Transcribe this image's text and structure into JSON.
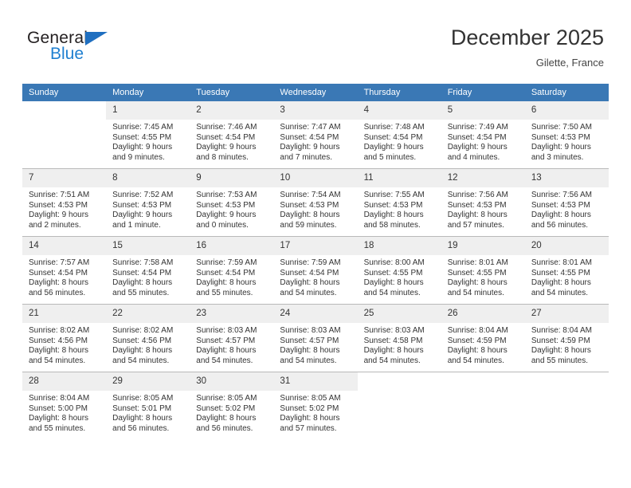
{
  "brand": {
    "name_part1": "General",
    "name_part2": "Blue",
    "triangle_icon": "triangle-icon",
    "colors": {
      "black": "#231f20",
      "blue": "#1f7fd0",
      "triangle": "#1f6fc0"
    }
  },
  "header": {
    "title": "December 2025",
    "location": "Gilette, France"
  },
  "calendar": {
    "header_bg": "#3a78b5",
    "daynum_bg": "#efefef",
    "weekdays": [
      "Sunday",
      "Monday",
      "Tuesday",
      "Wednesday",
      "Thursday",
      "Friday",
      "Saturday"
    ],
    "weeks": [
      [
        {
          "day": "",
          "sunrise": "",
          "sunset": "",
          "daylight": "",
          "empty": true
        },
        {
          "day": "1",
          "sunrise": "Sunrise: 7:45 AM",
          "sunset": "Sunset: 4:55 PM",
          "daylight": "Daylight: 9 hours and 9 minutes."
        },
        {
          "day": "2",
          "sunrise": "Sunrise: 7:46 AM",
          "sunset": "Sunset: 4:54 PM",
          "daylight": "Daylight: 9 hours and 8 minutes."
        },
        {
          "day": "3",
          "sunrise": "Sunrise: 7:47 AM",
          "sunset": "Sunset: 4:54 PM",
          "daylight": "Daylight: 9 hours and 7 minutes."
        },
        {
          "day": "4",
          "sunrise": "Sunrise: 7:48 AM",
          "sunset": "Sunset: 4:54 PM",
          "daylight": "Daylight: 9 hours and 5 minutes."
        },
        {
          "day": "5",
          "sunrise": "Sunrise: 7:49 AM",
          "sunset": "Sunset: 4:54 PM",
          "daylight": "Daylight: 9 hours and 4 minutes."
        },
        {
          "day": "6",
          "sunrise": "Sunrise: 7:50 AM",
          "sunset": "Sunset: 4:53 PM",
          "daylight": "Daylight: 9 hours and 3 minutes."
        }
      ],
      [
        {
          "day": "7",
          "sunrise": "Sunrise: 7:51 AM",
          "sunset": "Sunset: 4:53 PM",
          "daylight": "Daylight: 9 hours and 2 minutes."
        },
        {
          "day": "8",
          "sunrise": "Sunrise: 7:52 AM",
          "sunset": "Sunset: 4:53 PM",
          "daylight": "Daylight: 9 hours and 1 minute."
        },
        {
          "day": "9",
          "sunrise": "Sunrise: 7:53 AM",
          "sunset": "Sunset: 4:53 PM",
          "daylight": "Daylight: 9 hours and 0 minutes."
        },
        {
          "day": "10",
          "sunrise": "Sunrise: 7:54 AM",
          "sunset": "Sunset: 4:53 PM",
          "daylight": "Daylight: 8 hours and 59 minutes."
        },
        {
          "day": "11",
          "sunrise": "Sunrise: 7:55 AM",
          "sunset": "Sunset: 4:53 PM",
          "daylight": "Daylight: 8 hours and 58 minutes."
        },
        {
          "day": "12",
          "sunrise": "Sunrise: 7:56 AM",
          "sunset": "Sunset: 4:53 PM",
          "daylight": "Daylight: 8 hours and 57 minutes."
        },
        {
          "day": "13",
          "sunrise": "Sunrise: 7:56 AM",
          "sunset": "Sunset: 4:53 PM",
          "daylight": "Daylight: 8 hours and 56 minutes."
        }
      ],
      [
        {
          "day": "14",
          "sunrise": "Sunrise: 7:57 AM",
          "sunset": "Sunset: 4:54 PM",
          "daylight": "Daylight: 8 hours and 56 minutes."
        },
        {
          "day": "15",
          "sunrise": "Sunrise: 7:58 AM",
          "sunset": "Sunset: 4:54 PM",
          "daylight": "Daylight: 8 hours and 55 minutes."
        },
        {
          "day": "16",
          "sunrise": "Sunrise: 7:59 AM",
          "sunset": "Sunset: 4:54 PM",
          "daylight": "Daylight: 8 hours and 55 minutes."
        },
        {
          "day": "17",
          "sunrise": "Sunrise: 7:59 AM",
          "sunset": "Sunset: 4:54 PM",
          "daylight": "Daylight: 8 hours and 54 minutes."
        },
        {
          "day": "18",
          "sunrise": "Sunrise: 8:00 AM",
          "sunset": "Sunset: 4:55 PM",
          "daylight": "Daylight: 8 hours and 54 minutes."
        },
        {
          "day": "19",
          "sunrise": "Sunrise: 8:01 AM",
          "sunset": "Sunset: 4:55 PM",
          "daylight": "Daylight: 8 hours and 54 minutes."
        },
        {
          "day": "20",
          "sunrise": "Sunrise: 8:01 AM",
          "sunset": "Sunset: 4:55 PM",
          "daylight": "Daylight: 8 hours and 54 minutes."
        }
      ],
      [
        {
          "day": "21",
          "sunrise": "Sunrise: 8:02 AM",
          "sunset": "Sunset: 4:56 PM",
          "daylight": "Daylight: 8 hours and 54 minutes."
        },
        {
          "day": "22",
          "sunrise": "Sunrise: 8:02 AM",
          "sunset": "Sunset: 4:56 PM",
          "daylight": "Daylight: 8 hours and 54 minutes."
        },
        {
          "day": "23",
          "sunrise": "Sunrise: 8:03 AM",
          "sunset": "Sunset: 4:57 PM",
          "daylight": "Daylight: 8 hours and 54 minutes."
        },
        {
          "day": "24",
          "sunrise": "Sunrise: 8:03 AM",
          "sunset": "Sunset: 4:57 PM",
          "daylight": "Daylight: 8 hours and 54 minutes."
        },
        {
          "day": "25",
          "sunrise": "Sunrise: 8:03 AM",
          "sunset": "Sunset: 4:58 PM",
          "daylight": "Daylight: 8 hours and 54 minutes."
        },
        {
          "day": "26",
          "sunrise": "Sunrise: 8:04 AM",
          "sunset": "Sunset: 4:59 PM",
          "daylight": "Daylight: 8 hours and 54 minutes."
        },
        {
          "day": "27",
          "sunrise": "Sunrise: 8:04 AM",
          "sunset": "Sunset: 4:59 PM",
          "daylight": "Daylight: 8 hours and 55 minutes."
        }
      ],
      [
        {
          "day": "28",
          "sunrise": "Sunrise: 8:04 AM",
          "sunset": "Sunset: 5:00 PM",
          "daylight": "Daylight: 8 hours and 55 minutes."
        },
        {
          "day": "29",
          "sunrise": "Sunrise: 8:05 AM",
          "sunset": "Sunset: 5:01 PM",
          "daylight": "Daylight: 8 hours and 56 minutes."
        },
        {
          "day": "30",
          "sunrise": "Sunrise: 8:05 AM",
          "sunset": "Sunset: 5:02 PM",
          "daylight": "Daylight: 8 hours and 56 minutes."
        },
        {
          "day": "31",
          "sunrise": "Sunrise: 8:05 AM",
          "sunset": "Sunset: 5:02 PM",
          "daylight": "Daylight: 8 hours and 57 minutes."
        },
        {
          "day": "",
          "sunrise": "",
          "sunset": "",
          "daylight": "",
          "empty": true
        },
        {
          "day": "",
          "sunrise": "",
          "sunset": "",
          "daylight": "",
          "empty": true
        },
        {
          "day": "",
          "sunrise": "",
          "sunset": "",
          "daylight": "",
          "empty": true
        }
      ]
    ]
  }
}
